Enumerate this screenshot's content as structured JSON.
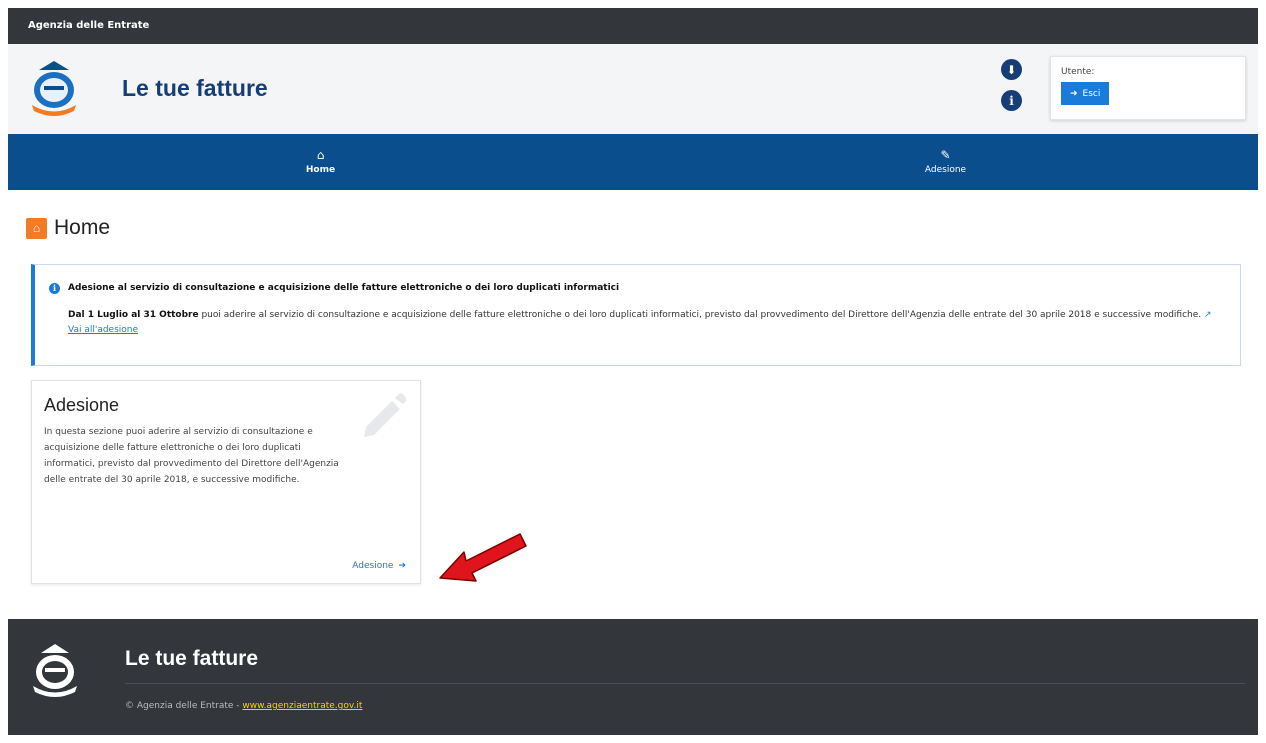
{
  "topbar": {
    "title": "Agenzia delle Entrate"
  },
  "header": {
    "app_title": "Le tue fatture",
    "user_label": "Utente:",
    "exit_label": "Esci"
  },
  "nav": {
    "items": [
      {
        "label": "Home",
        "icon": "home-icon"
      },
      {
        "label": "Adesione",
        "icon": "pencil-icon"
      }
    ]
  },
  "page": {
    "title": "Home"
  },
  "alert": {
    "heading": "Adesione al servizio di consultazione e acquisizione delle fatture elettroniche o dei loro duplicati informatici",
    "bold_period": "Dal 1 Luglio al 31 Ottobre",
    "body": " puoi aderire al servizio di consultazione e acquisizione delle fatture elettroniche o dei loro duplicati informatici, previsto dal provvedimento del Direttore dell'Agenzia delle entrate del 30 aprile 2018 e successive modifiche.",
    "link_label": "Vai all'adesione"
  },
  "card": {
    "title": "Adesione",
    "text": "In questa sezione puoi aderire al servizio di consultazione e acquisizione delle fatture elettroniche o dei loro duplicati informatici, previsto dal provvedimento del Direttore dell'Agenzia delle entrate del 30 aprile 2018, e successive modifiche.",
    "link_label": "Adesione"
  },
  "footer": {
    "title": "Le tue fatture",
    "copyright": "© Agenzia delle Entrate - ",
    "site_link": "www.agenziaentrate.gov.it"
  },
  "colors": {
    "nav_bg": "#0b4e8e",
    "primary": "#1b7bd8",
    "dark": "#33363b",
    "home_accent": "#f47a24",
    "annotation_arrow": "#e0141c"
  }
}
